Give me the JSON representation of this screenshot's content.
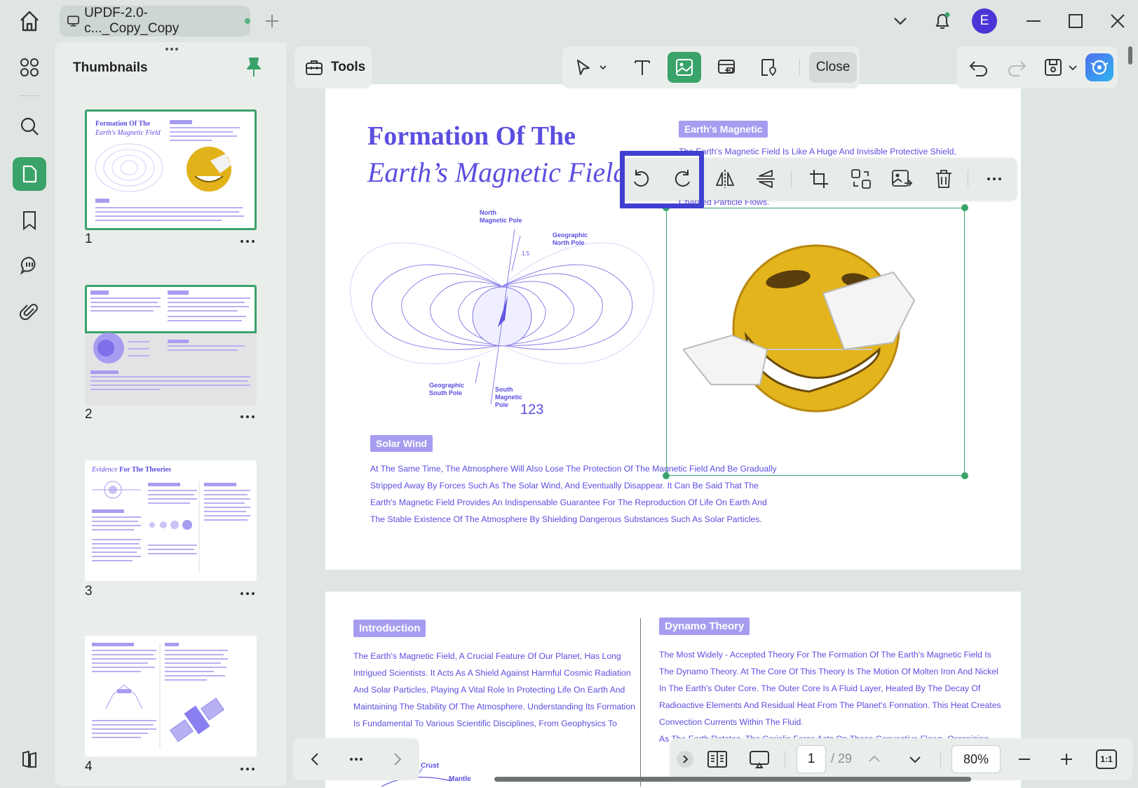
{
  "tab": {
    "title": "UPDF-2.0-c..._Copy_Copy"
  },
  "user": {
    "initial": "E"
  },
  "sidebar": {
    "title": "Thumbnails",
    "pages": [
      "1",
      "2",
      "3",
      "4"
    ]
  },
  "tools": {
    "label": "Tools"
  },
  "toolbar": {
    "close_label": "Close"
  },
  "page1": {
    "title_line1": "Formation Of The",
    "title_line2": "Earth’s Magnetic Field",
    "earth_label": "Earth's Magnetic",
    "earth_text": "The Earth's Magnetic Field Is Like A Huge And Invisible Protective Shield,",
    "earth_text2": "Charged Particle Flows.",
    "diagram": {
      "north_magnetic": "North\nMagnetic Pole",
      "geo_north": "Geographic\nNorth Pole",
      "geo_south": "Geographic\nSouth Pole",
      "south_magnetic": "South\nMagnetic\nPole",
      "angle": "1.5",
      "num": "123"
    },
    "solar_label": "Solar Wind",
    "solar_text": [
      "At The Same Time, The Atmosphere Will Also Lose The Protection Of The Magnetic Field And Be Gradually",
      "Stripped Away By Forces Such As The Solar Wind, And Eventually Disappear. It Can Be Said That The",
      "Earth's Magnetic Field Provides An Indispensable Guarantee For The Reproduction Of Life On Earth And",
      "The Stable Existence Of The Atmosphere By Shielding Dangerous Substances Such As Solar Particles."
    ]
  },
  "page2": {
    "intro_label": "Introduction",
    "intro_text": [
      "The Earth's Magnetic Field, A Crucial Feature Of Our Planet, Has Long",
      "Intrigued Scientists. It Acts As A Shield Against Harmful Cosmic Radiation",
      "And Solar Particles, Playing A Vital Role In Protecting Life On Earth And",
      "Maintaining The Stability Of The Atmosphere. Understanding Its Formation",
      "Is Fundamental To Various Scientific Disciplines, From Geophysics To"
    ],
    "dynamo_label": "Dynamo Theory",
    "dynamo_text": [
      "The Most Widely - Accepted Theory For The Formation Of The Earth's Magnetic Field Is",
      "The Dynamo Theory. At The Core Of This Theory Is The Motion Of Molten Iron And Nickel",
      "In The Earth's Outer Core. The Outer Core Is A Fluid Layer, Heated By The Decay Of",
      "Radioactive Elements And Residual Heat From The Planet's Formation. This Heat Creates",
      "Convection Currents Within The Fluid."
    ],
    "dynamo_cut": "As The Earth Rotates, The Coriolis Force Acts On These Convective Flows, Organizing",
    "crust": "Crust",
    "mantle": "Mantle"
  },
  "thumb3": {
    "title_em": "Evidence",
    "title_rest": " For The Theories"
  },
  "pager": {
    "current": "1",
    "total": "/ 29",
    "zoom": "80%",
    "fit": "1:1"
  }
}
